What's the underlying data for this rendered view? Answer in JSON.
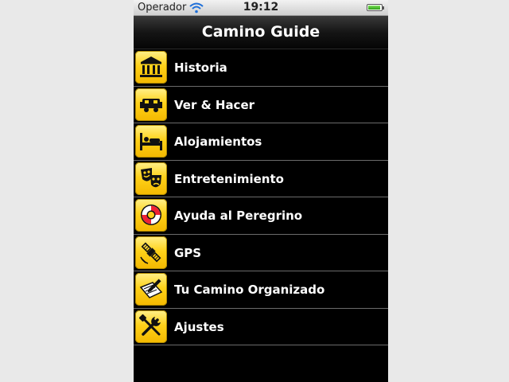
{
  "status_bar": {
    "carrier": "Operador",
    "time": "19:12",
    "battery_level": 0.92
  },
  "nav_bar": {
    "title": "Camino Guide"
  },
  "menu": {
    "items": [
      {
        "label": "Historia",
        "icon": "museum-icon"
      },
      {
        "label": "Ver & Hacer",
        "icon": "sightseeing-icon"
      },
      {
        "label": "Alojamientos",
        "icon": "bed-icon"
      },
      {
        "label": "Entretenimiento",
        "icon": "theater-masks-icon"
      },
      {
        "label": "Ayuda al Peregrino",
        "icon": "lifebuoy-icon"
      },
      {
        "label": "GPS",
        "icon": "satellite-icon"
      },
      {
        "label": "Tu Camino Organizado",
        "icon": "pencil-notepad-icon"
      },
      {
        "label": "Ajustes",
        "icon": "tools-icon"
      }
    ]
  },
  "colors": {
    "icon_yellow": "#ffd21a",
    "list_background": "#000000",
    "text": "#ffffff"
  }
}
